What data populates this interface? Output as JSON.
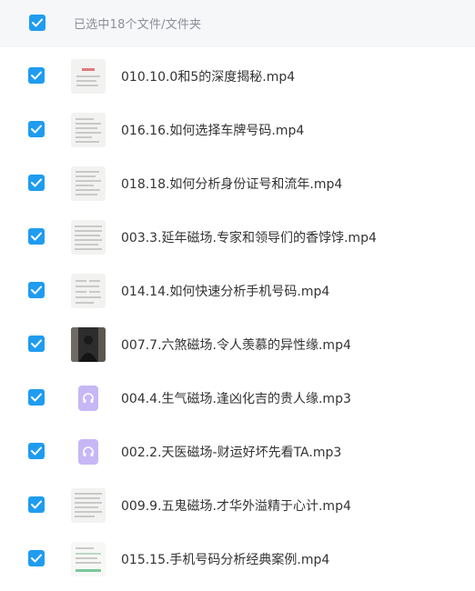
{
  "header": {
    "selected_label": "已选中18个文件/文件夹",
    "accent_color": "#1f9cf0"
  },
  "files": [
    {
      "name": "010.10.0和5的深度揭秘.mp4",
      "thumb": "doc-red"
    },
    {
      "name": "016.16.如何选择车牌号码.mp4",
      "thumb": "doc"
    },
    {
      "name": "018.18.如何分析身份证号和流年.mp4",
      "thumb": "doc"
    },
    {
      "name": "003.3.延年磁场.专家和领导们的香饽饽.mp4",
      "thumb": "doc"
    },
    {
      "name": "014.14.如何快速分析手机号码.mp4",
      "thumb": "doc"
    },
    {
      "name": "007.7.六煞磁场.令人羡慕的异性缘.mp4",
      "thumb": "dark-video"
    },
    {
      "name": "004.4.生气磁场.逢凶化吉的贵人缘.mp3",
      "thumb": "audio-icon"
    },
    {
      "name": "002.2.天医磁场-财运好坏先看TA.mp3",
      "thumb": "audio-icon"
    },
    {
      "name": "009.9.五鬼磁场.才华外溢精于心计.mp4",
      "thumb": "doc"
    },
    {
      "name": "015.15.手机号码分析经典案例.mp4",
      "thumb": "doc-green"
    }
  ]
}
